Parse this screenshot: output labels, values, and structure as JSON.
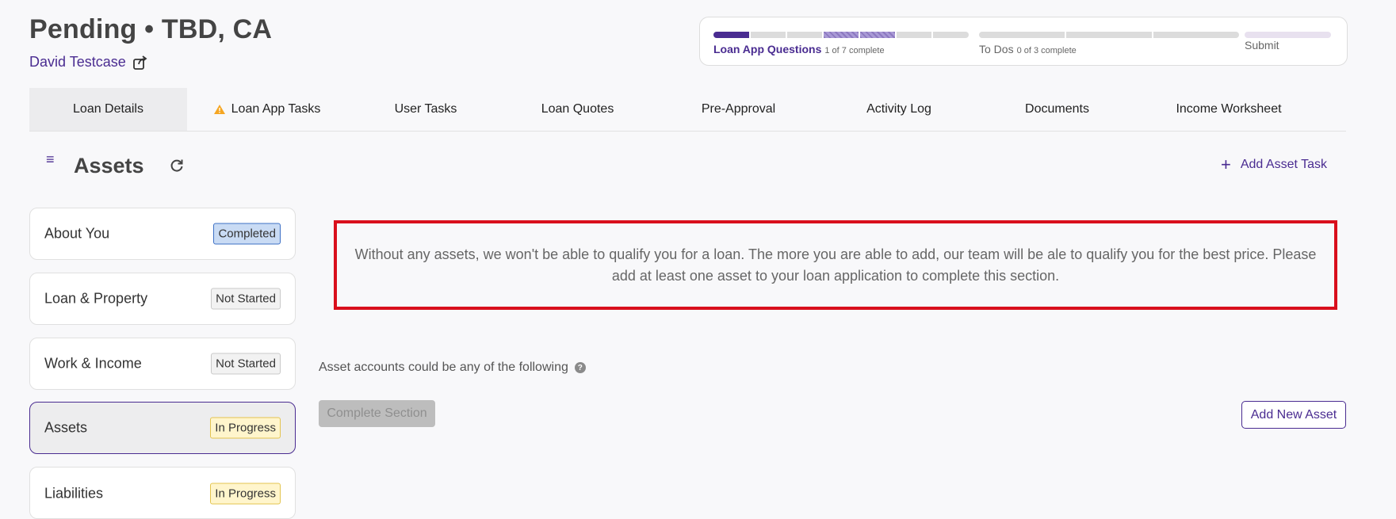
{
  "header": {
    "title": "Pending • TBD, CA",
    "borrower_name": "David Testcase"
  },
  "progress": {
    "steps": [
      {
        "label": "Loan App Questions",
        "detail": "1 of 7 complete"
      },
      {
        "label": "To Dos",
        "detail": "0 of 3 complete"
      },
      {
        "label": "Submit",
        "detail": ""
      }
    ]
  },
  "tabs": [
    {
      "label": "Loan Details",
      "active": true
    },
    {
      "label": "Loan App Tasks",
      "icon": "warning-icon"
    },
    {
      "label": "User Tasks"
    },
    {
      "label": "Loan Quotes"
    },
    {
      "label": "Pre-Approval"
    },
    {
      "label": "Activity Log"
    },
    {
      "label": "Documents"
    },
    {
      "label": "Income Worksheet"
    }
  ],
  "section": {
    "title": "Assets",
    "add_task_label": "Add Asset Task"
  },
  "sidebar": {
    "items": [
      {
        "label": "About You",
        "status": "Completed"
      },
      {
        "label": "Loan & Property",
        "status": "Not Started"
      },
      {
        "label": "Work & Income",
        "status": "Not Started"
      },
      {
        "label": "Assets",
        "status": "In Progress"
      },
      {
        "label": "Liabilities",
        "status": "In Progress"
      }
    ]
  },
  "main": {
    "alert": "Without any assets, we won't be able to qualify you for a loan. The more you are able to add, our team will be ale to qualify you for the best price. Please add at least one asset to your loan application to complete this section.",
    "asset_accounts_text": "Asset accounts could be any of the following",
    "complete_section_label": "Complete Section",
    "add_new_asset_label": "Add New Asset"
  },
  "colors": {
    "accent": "#4a2c91",
    "alert_border": "#d90f1c",
    "warning": "#f5a623"
  }
}
